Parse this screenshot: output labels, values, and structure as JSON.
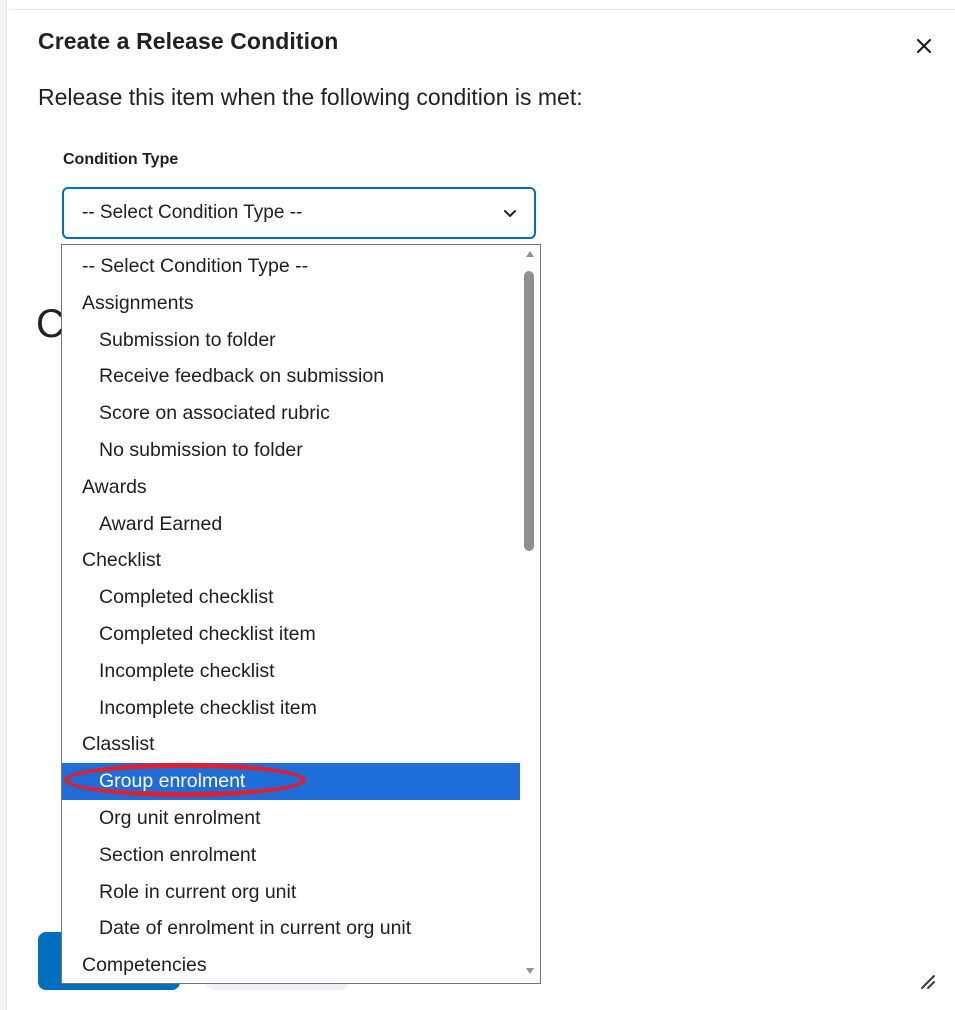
{
  "dialog": {
    "title": "Create a Release Condition",
    "close_label": "×",
    "intro": "Release this item when the following condition is met:"
  },
  "condition_type": {
    "label": "Condition Type",
    "selected_value": "-- Select Condition Type --"
  },
  "background": {
    "partial_heading": "C"
  },
  "dropdown": {
    "options": [
      {
        "label": "-- Select Condition Type --",
        "level": "group"
      },
      {
        "label": "Assignments",
        "level": "group"
      },
      {
        "label": "Submission to folder",
        "level": "child"
      },
      {
        "label": "Receive feedback on submission",
        "level": "child"
      },
      {
        "label": "Score on associated rubric",
        "level": "child"
      },
      {
        "label": "No submission to folder",
        "level": "child"
      },
      {
        "label": "Awards",
        "level": "group"
      },
      {
        "label": "Award Earned",
        "level": "child"
      },
      {
        "label": "Checklist",
        "level": "group"
      },
      {
        "label": "Completed checklist",
        "level": "child"
      },
      {
        "label": "Completed checklist item",
        "level": "child"
      },
      {
        "label": "Incomplete checklist",
        "level": "child"
      },
      {
        "label": "Incomplete checklist item",
        "level": "child"
      },
      {
        "label": "Classlist",
        "level": "group"
      },
      {
        "label": "Group enrolment",
        "level": "child",
        "selected": true
      },
      {
        "label": "Org unit enrolment",
        "level": "child"
      },
      {
        "label": "Section enrolment",
        "level": "child"
      },
      {
        "label": "Role in current org unit",
        "level": "child"
      },
      {
        "label": "Date of enrolment in current org unit",
        "level": "child"
      },
      {
        "label": "Competencies",
        "level": "group"
      }
    ]
  },
  "colors": {
    "accent": "#006fbf",
    "selected_option": "#1f6dd8",
    "annotation_ring": "#e0202b"
  },
  "icons": {
    "close": "close-icon",
    "chevron": "chevron-down-icon",
    "resize": "resize-handle-icon"
  }
}
